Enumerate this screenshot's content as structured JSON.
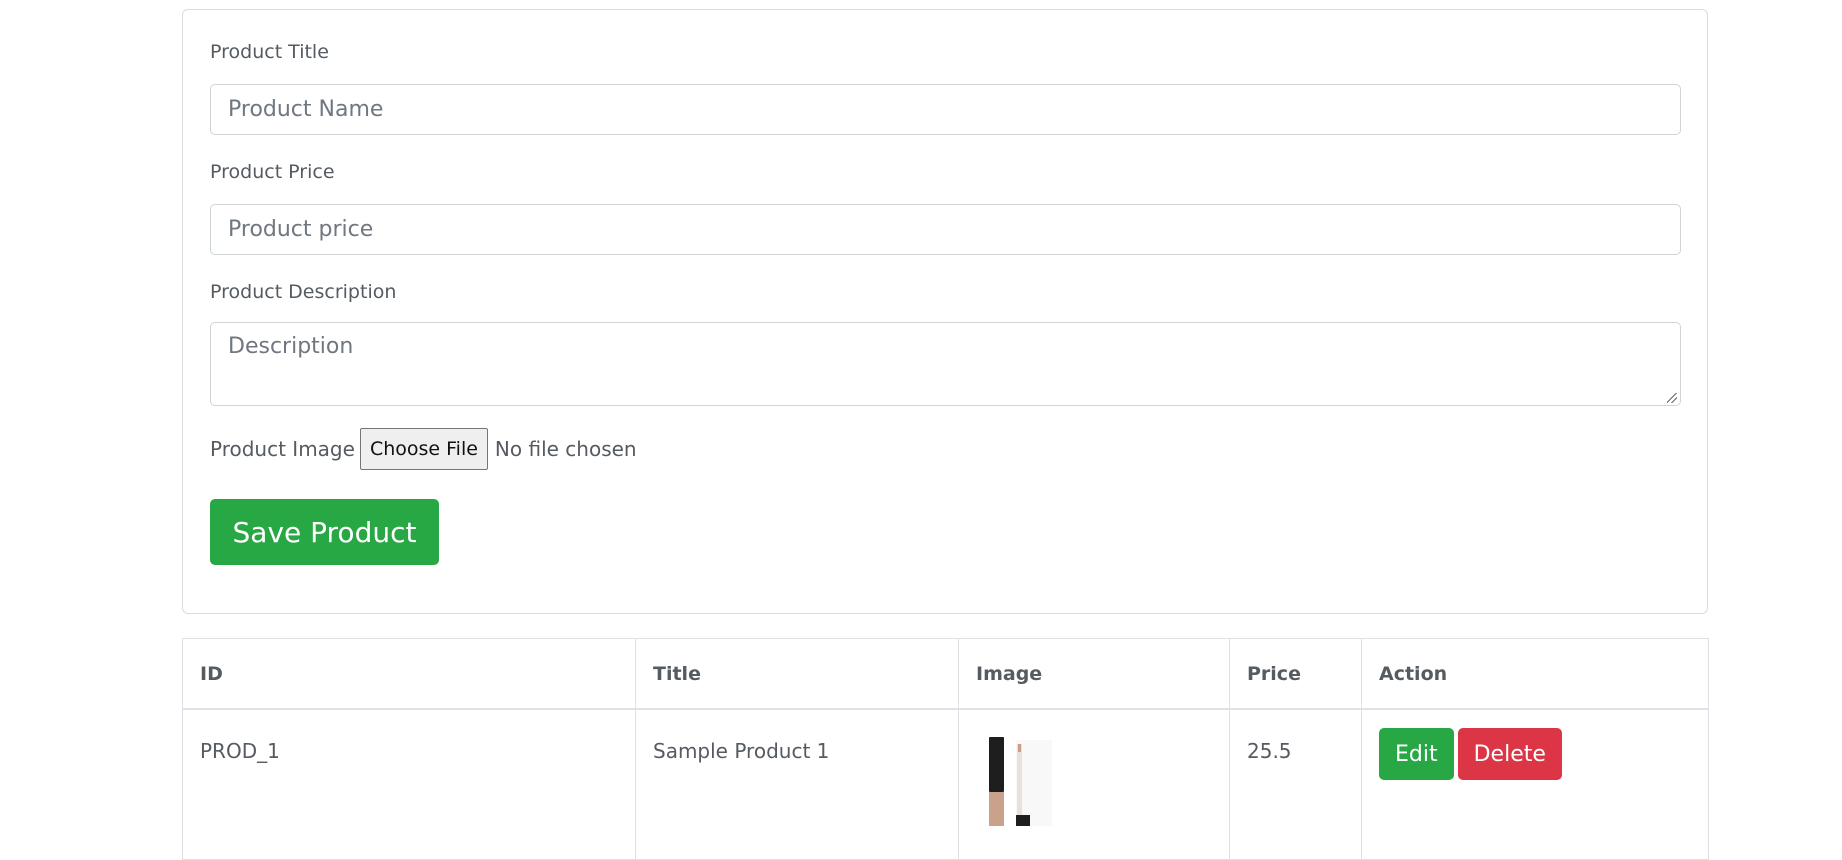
{
  "form": {
    "title_label": "Product Title",
    "title_placeholder": "Product Name",
    "price_label": "Product Price",
    "price_placeholder": "Product price",
    "description_label": "Product Description",
    "description_placeholder": "Description",
    "image_label": "Product Image",
    "file_button_label": "Choose File",
    "file_status": "No file chosen",
    "save_label": "Save Product"
  },
  "table": {
    "headers": {
      "id": "ID",
      "title": "Title",
      "image": "Image",
      "price": "Price",
      "action": "Action"
    },
    "rows": [
      {
        "id": "PROD_1",
        "title": "Sample Product 1",
        "image_icon": "product-thumbnail",
        "price": "25.5",
        "edit_label": "Edit",
        "delete_label": "Delete"
      }
    ]
  },
  "colors": {
    "success": "#28a745",
    "danger": "#dc3545"
  }
}
